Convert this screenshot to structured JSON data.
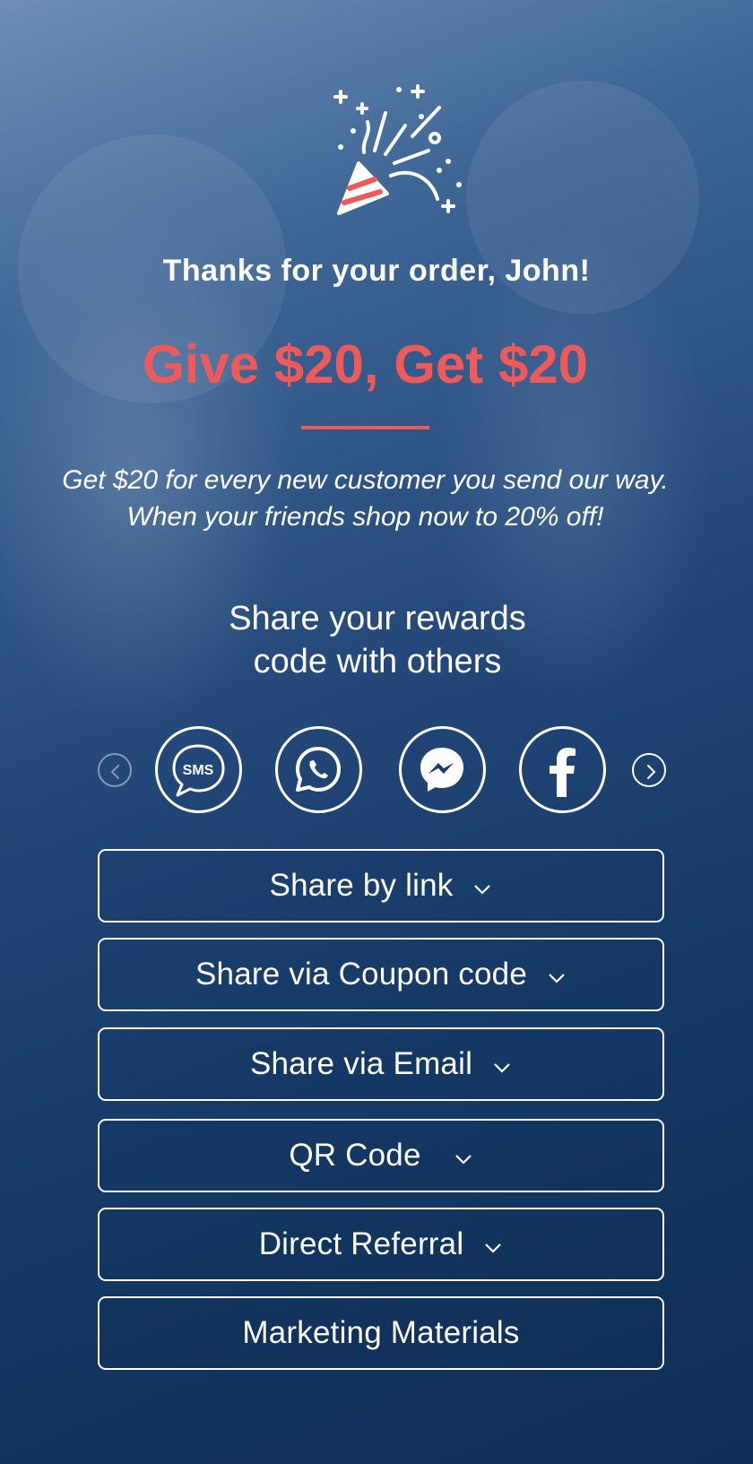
{
  "header": {
    "thanks": "Thanks for your order, John!",
    "headline": "Give $20, Get $20",
    "subtext_line1": "Get $20 for every new customer you send our way.",
    "subtext_line2": "When your friends shop now to 20% off!"
  },
  "share": {
    "heading_line1": "Share your rewards",
    "heading_line2": "code with others",
    "sms_icon_text": "SMS",
    "social": [
      {
        "icon": "sms-icon"
      },
      {
        "icon": "whatsapp-icon"
      },
      {
        "icon": "messenger-icon"
      },
      {
        "icon": "facebook-icon"
      }
    ],
    "options": [
      {
        "label": "Share by link",
        "has_chevron": true
      },
      {
        "label": "Share via Coupon code",
        "has_chevron": true
      },
      {
        "label": "Share via Email",
        "has_chevron": true
      },
      {
        "label": "QR Code",
        "has_chevron": true
      },
      {
        "label": "Direct Referral",
        "has_chevron": true
      },
      {
        "label": "Marketing Materials",
        "has_chevron": false
      }
    ]
  },
  "colors": {
    "accent": "#ee5a5a",
    "background": "#0f3158",
    "text": "#ffffff"
  }
}
